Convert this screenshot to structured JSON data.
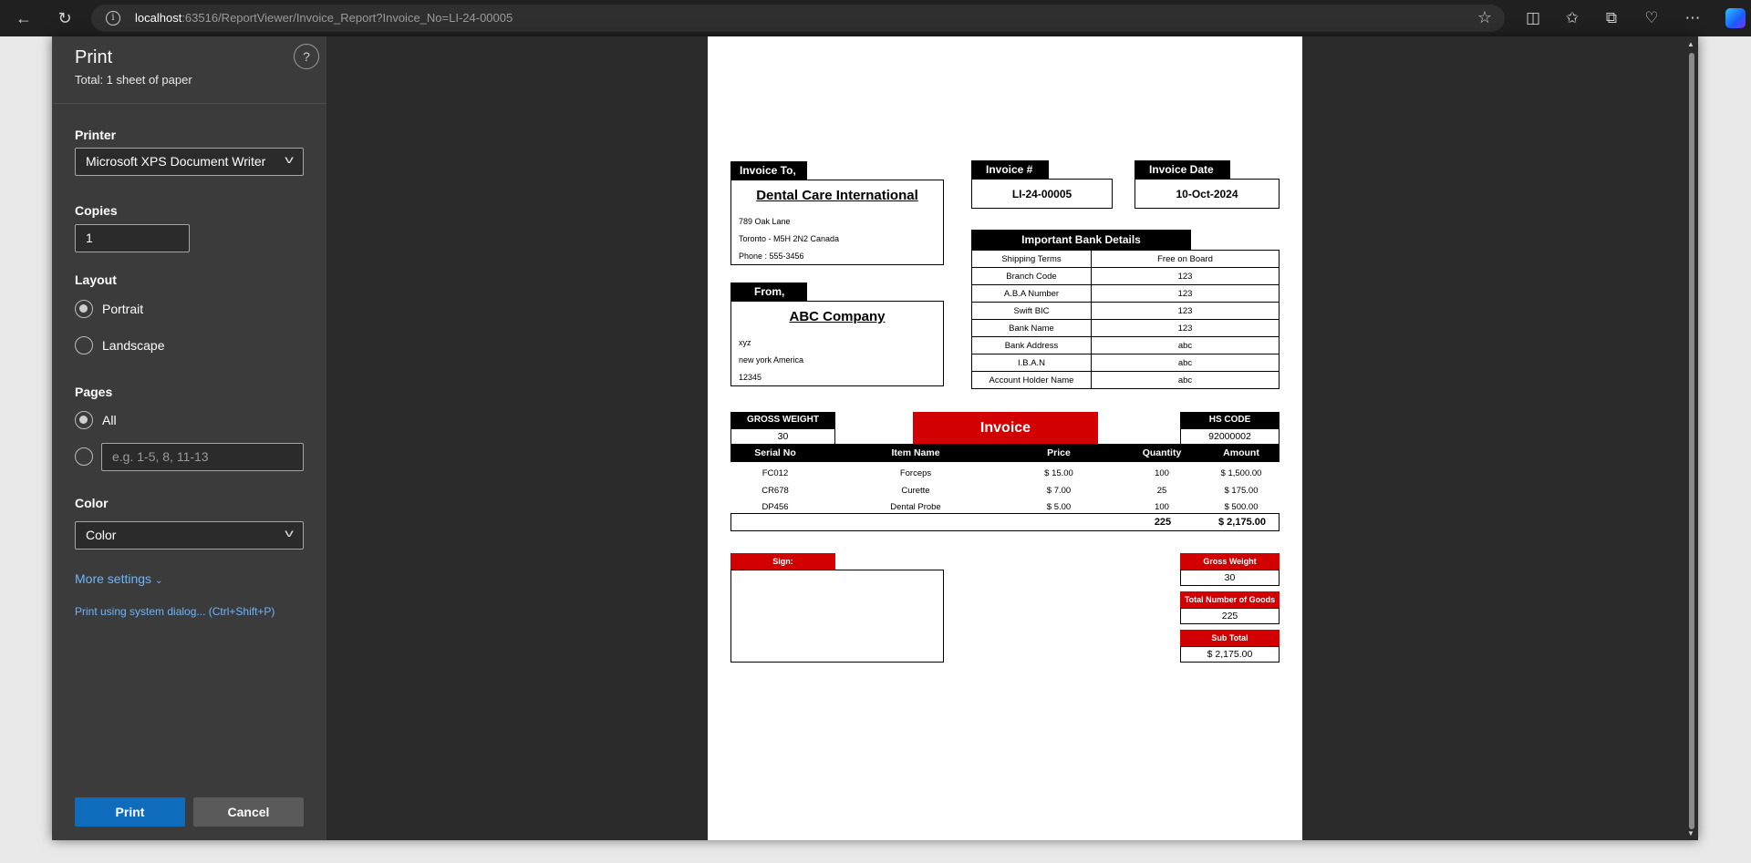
{
  "browser": {
    "url_host": "localhost",
    "url_rest": ":63516/ReportViewer/Invoice_Report?Invoice_No=LI-24-00005"
  },
  "print_panel": {
    "title": "Print",
    "subtitle": "Total: 1 sheet of paper",
    "help": "?",
    "printer_label": "Printer",
    "printer_value": "Microsoft XPS Document Writer",
    "copies_label": "Copies",
    "copies_value": "1",
    "layout_label": "Layout",
    "portrait": "Portrait",
    "landscape": "Landscape",
    "pages_label": "Pages",
    "pages_all": "All",
    "pages_placeholder": "e.g. 1-5, 8, 11-13",
    "color_label": "Color",
    "color_value": "Color",
    "more_settings": "More settings",
    "system_dialog": "Print using system dialog... (Ctrl+Shift+P)",
    "print_button": "Print",
    "cancel_button": "Cancel"
  },
  "invoice": {
    "invoice_to_label": "Invoice To,",
    "to_name": "Dental Care International",
    "to_line1": "789 Oak Lane",
    "to_line2": "Toronto - M5H 2N2 Canada",
    "to_line3": "Phone : 555-3456",
    "from_label": "From,",
    "from_name": "ABC Company",
    "from_line1": "xyz",
    "from_line2": "new york America",
    "from_line3": "12345",
    "invoice_no_label": "Invoice #",
    "invoice_no": "LI-24-00005",
    "invoice_date_label": "Invoice Date",
    "invoice_date": "10-Oct-2024",
    "bank_title": "Important Bank Details",
    "bank": [
      {
        "k": "Shipping Terms",
        "v": "Free on Board"
      },
      {
        "k": "Branch Code",
        "v": "123"
      },
      {
        "k": "A.B.A Number",
        "v": "123"
      },
      {
        "k": "Swift BIC",
        "v": "123"
      },
      {
        "k": "Bank Name",
        "v": "123"
      },
      {
        "k": "Bank Address",
        "v": "abc"
      },
      {
        "k": "I.B.A.N",
        "v": "abc"
      },
      {
        "k": "Account Holder Name",
        "v": "abc"
      }
    ],
    "gross_weight_label": "GROSS WEIGHT",
    "gross_weight": "30",
    "title": "Invoice",
    "hs_code_label": "HS CODE",
    "hs_code": "92000002",
    "columns": [
      "Serial No",
      "Item Name",
      "Price",
      "Quantity",
      "Amount"
    ],
    "items": [
      {
        "serial": "FC012",
        "name": "Forceps",
        "price": "$ 15.00",
        "qty": "100",
        "amount": "$ 1,500.00"
      },
      {
        "serial": "CR678",
        "name": "Curette",
        "price": "$ 7.00",
        "qty": "25",
        "amount": "$ 175.00"
      },
      {
        "serial": "DP456",
        "name": "Dental Probe",
        "price": "$ 5.00",
        "qty": "100",
        "amount": "$ 500.00"
      }
    ],
    "total_qty": "225",
    "total_amount": "$ 2,175.00",
    "sign_label": "Sign:",
    "summary_gross_label": "Gross Weight",
    "summary_gross": "30",
    "summary_goods_label": "Total Number of Goods",
    "summary_goods": "225",
    "summary_subtotal_label": "Sub Total",
    "summary_subtotal": "$ 2,175.00"
  }
}
